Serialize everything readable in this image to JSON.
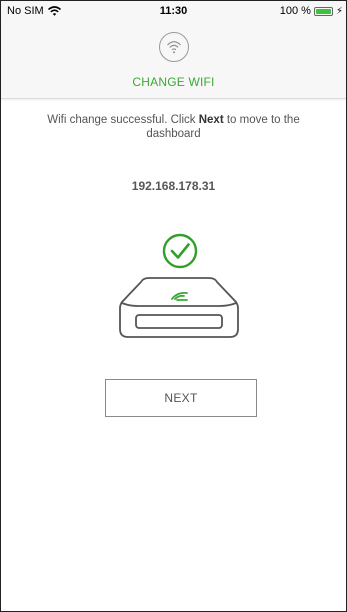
{
  "status_bar": {
    "carrier": "No SIM",
    "time": "11:30",
    "battery_percent": "100 %",
    "battery_level": 1.0,
    "wifi_icon": "wifi-signal-icon",
    "charging_icon": "charging-bolt-icon",
    "battery_color": "#3cc23c"
  },
  "header": {
    "icon": "wifi-icon",
    "title": "CHANGE WIFI",
    "title_color": "#3aaa35"
  },
  "content": {
    "message_part1": "Wifi change successful. Click ",
    "message_bold": "Next",
    "message_part2": " to move to the dashboard",
    "ip_address": "192.168.178.31",
    "success_icon": "check-circle-icon",
    "success_color": "#2fa02a",
    "device_icon": "router-device-icon"
  },
  "actions": {
    "next_label": "NEXT"
  }
}
